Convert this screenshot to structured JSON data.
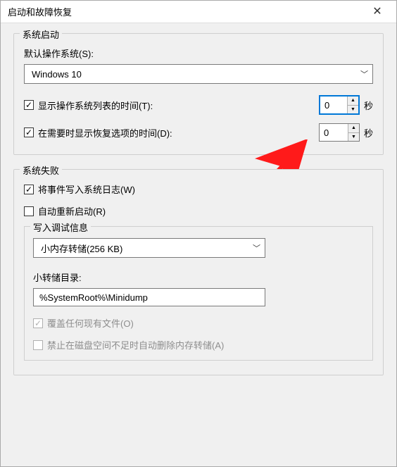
{
  "window": {
    "title": "启动和故障恢复"
  },
  "systemStartup": {
    "groupTitle": "系统启动",
    "defaultOsLabel": "默认操作系统(S):",
    "defaultOsValue": "Windows 10",
    "showOsListLabel": "显示操作系统列表的时间(T):",
    "showOsListValue": "0",
    "recoveryOptionsLabel": "在需要时显示恢复选项的时间(D):",
    "recoveryOptionsValue": "0",
    "secondsUnit": "秒"
  },
  "systemFailure": {
    "groupTitle": "系统失败",
    "writeEventLabel": "将事件写入系统日志(W)",
    "autoRestartLabel": "自动重新启动(R)",
    "debugInfo": {
      "title": "写入调试信息",
      "dumpTypeValue": "小内存转储(256 KB)",
      "dumpDirLabel": "小转储目录:",
      "dumpDirValue": "%SystemRoot%\\Minidump",
      "overwriteLabel": "覆盖任何现有文件(O)",
      "disableOnLowDiskLabel": "禁止在磁盘空间不足时自动删除内存转储(A)"
    }
  }
}
